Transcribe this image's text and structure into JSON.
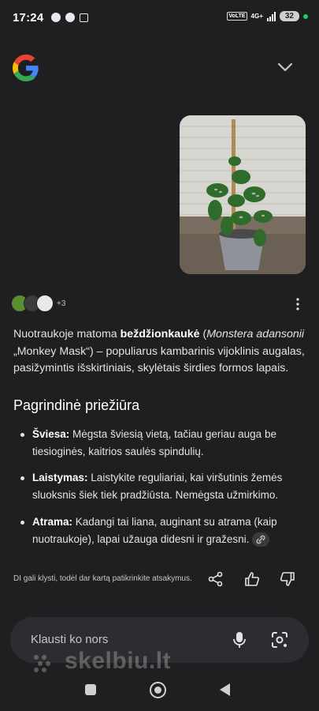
{
  "status_bar": {
    "time": "17:24",
    "network": "4G+",
    "battery": "32",
    "volte": "VoLTE"
  },
  "header": {
    "logo": "google-g-logo",
    "collapse_icon": "chevron-down-icon"
  },
  "image_attachment": {
    "subject": "monstera-plant-photo"
  },
  "sources": {
    "more_count": "+3"
  },
  "answer": {
    "p1_a": "Nuotraukoje matoma ",
    "p1_b": "beždžionkaukė",
    "p1_c": " (",
    "p1_d": "Monstera adansonii",
    "p1_e": " „Monkey Mask“) – populiarus kambarinis vijoklinis augalas, pasižymintis išskirtiniais, skylėtais širdies formos lapais."
  },
  "section": {
    "title": "Pagrindinė priežiūra",
    "items": [
      {
        "label": "Šviesa:",
        "text": " Mėgsta šviesią vietą, tačiau geriau auga be tiesioginės, kaitrios saulės spindulių."
      },
      {
        "label": "Laistymas:",
        "text": " Laistykite reguliariai, kai viršutinis žemės sluoksnis šiek tiek pradžiūsta. Nemėgsta užmirkimo."
      },
      {
        "label": "Atrama:",
        "text": " Kadangi tai liana, auginant su atrama (kaip nuotraukoje), lapai užauga didesni ir gražesni."
      }
    ]
  },
  "footer": {
    "disclaimer": "DI gali klysti, todėl dar kartą patikrinkite atsakymus."
  },
  "input": {
    "placeholder": "Klausti ko nors"
  },
  "watermark": {
    "text": "skelbiu.lt"
  },
  "colors": {
    "background": "#1f1f21",
    "input_bg": "#2c2d30",
    "text": "#e3e3e3"
  }
}
